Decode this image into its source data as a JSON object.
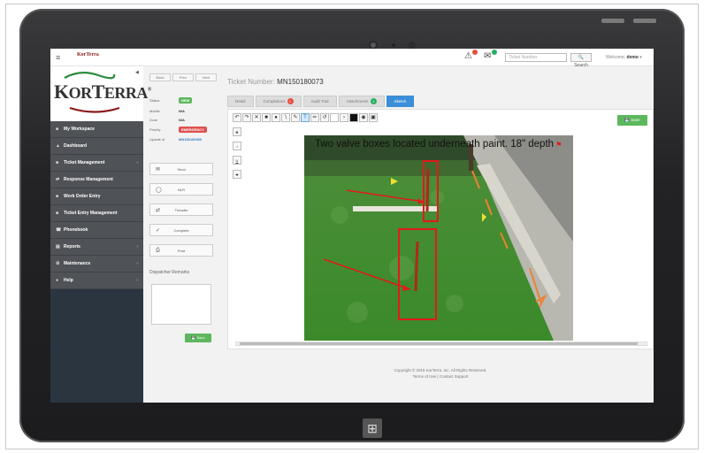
{
  "header": {
    "ticket_search_placeholder": "Ticket Number",
    "search_label": "Search",
    "welcome_prefix": "Welcome,",
    "welcome_user": "demo"
  },
  "logo": {
    "text": "KorTerra"
  },
  "sidebar": {
    "items": [
      {
        "label": "My Workspace",
        "chev": ""
      },
      {
        "label": "Dashboard",
        "chev": ""
      },
      {
        "label": "Ticket Management",
        "chev": "‹"
      },
      {
        "label": "Response Management",
        "chev": ""
      },
      {
        "label": "Work Order Entry",
        "chev": ""
      },
      {
        "label": "Ticket Entry Management",
        "chev": ""
      },
      {
        "label": "Phonebook",
        "chev": ""
      },
      {
        "label": "Reports",
        "chev": "‹"
      },
      {
        "label": "Maintenance",
        "chev": "‹"
      },
      {
        "label": "Help",
        "chev": "‹"
      }
    ]
  },
  "ticket": {
    "title_prefix": "Ticket Number:",
    "number": "MN150180073",
    "nav": [
      "Back",
      "Prev",
      "Next"
    ],
    "fields": [
      {
        "label": "Status",
        "value": "NEW"
      },
      {
        "label": "Mobile",
        "value": "N/A"
      },
      {
        "label": "Zone",
        "value": "N/A"
      },
      {
        "label": "Priority",
        "value": "EMERGENCY"
      },
      {
        "label": "Update of",
        "value": "MN150180066"
      }
    ],
    "actions": [
      "Send",
      "NLR",
      "Transfer",
      "Complete",
      "Print"
    ],
    "remarks_title": "Dispatcher Remarks",
    "save_label": "Save"
  },
  "tabs": [
    {
      "label": "Detail",
      "badge": ""
    },
    {
      "label": "Completions",
      "badge": "1"
    },
    {
      "label": "Audit Trail",
      "badge": ""
    },
    {
      "label": "Attachments",
      "badge": "1"
    },
    {
      "label": "Sketch",
      "badge": ""
    }
  ],
  "sketch": {
    "caption": "Two valve boxes located underneath paint. 18\" depth",
    "save_label": "Save",
    "side_tools": [
      "B",
      "I",
      "U",
      "S"
    ]
  },
  "footer": {
    "line1": "Copyright © 2015 KorTerra, Inc. All Rights Reserved.",
    "line2": "Terms of Use | Contact Support"
  },
  "colors": {
    "brand": "#8a1a1a",
    "accent": "#3b8fd8",
    "success": "#5cb85c",
    "danger": "#e05050"
  }
}
